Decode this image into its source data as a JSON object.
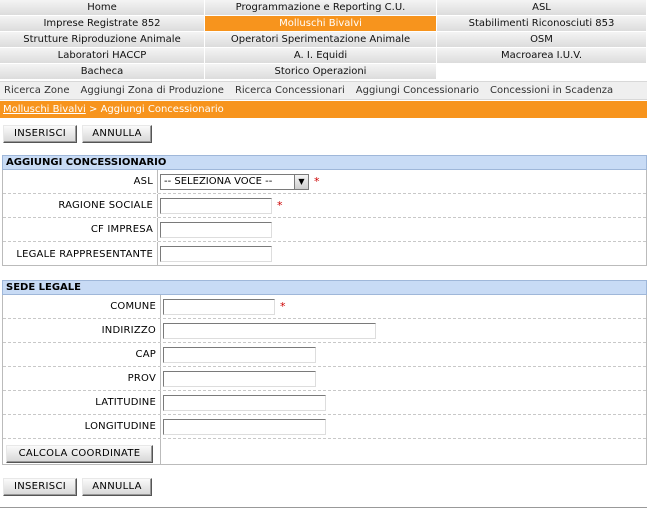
{
  "menu": [
    [
      "Home",
      "Programmazione e Reporting C.U.",
      "ASL"
    ],
    [
      "Imprese Registrate 852",
      "Molluschi Bivalvi",
      "Stabilimenti Riconosciuti 853"
    ],
    [
      "Strutture Riproduzione Animale",
      "Operatori Sperimentazione Animale",
      "OSM"
    ],
    [
      "Laboratori HACCP",
      "A. I. Equidi",
      "Macroarea I.U.V."
    ],
    [
      "Bacheca",
      "Storico Operazioni",
      ""
    ]
  ],
  "menu_active": "Molluschi Bivalvi",
  "submenu": [
    "Ricerca Zone",
    "Aggiungi Zona di Produzione",
    "Ricerca Concessionari",
    "Aggiungi Concessionario",
    "Concessioni in Scadenza"
  ],
  "breadcrumb": {
    "link": "Molluschi Bivalvi",
    "sep": " > ",
    "current": "Aggiungi Concessionario"
  },
  "buttons": {
    "insert": "INSERISCI",
    "cancel": "ANNULLA",
    "calc": "CALCOLA COORDINATE"
  },
  "section1": {
    "title": "AGGIUNGI CONCESSIONARIO",
    "asl_label": "ASL",
    "asl_value": "-- SELEZIONA VOCE --",
    "ragione_label": "RAGIONE SOCIALE",
    "cf_label": "CF IMPRESA",
    "legale_label": "LEGALE RAPPRESENTANTE"
  },
  "section2": {
    "title": "SEDE LEGALE",
    "comune_label": "COMUNE",
    "indirizzo_label": "INDIRIZZO",
    "cap_label": "CAP",
    "prov_label": "PROV",
    "lat_label": "LATITUDINE",
    "lon_label": "LONGITUDINE"
  },
  "required_mark": "*",
  "colors": {
    "accent": "#f7941d",
    "section": "#c8dbf5",
    "required": "#cc0000"
  }
}
